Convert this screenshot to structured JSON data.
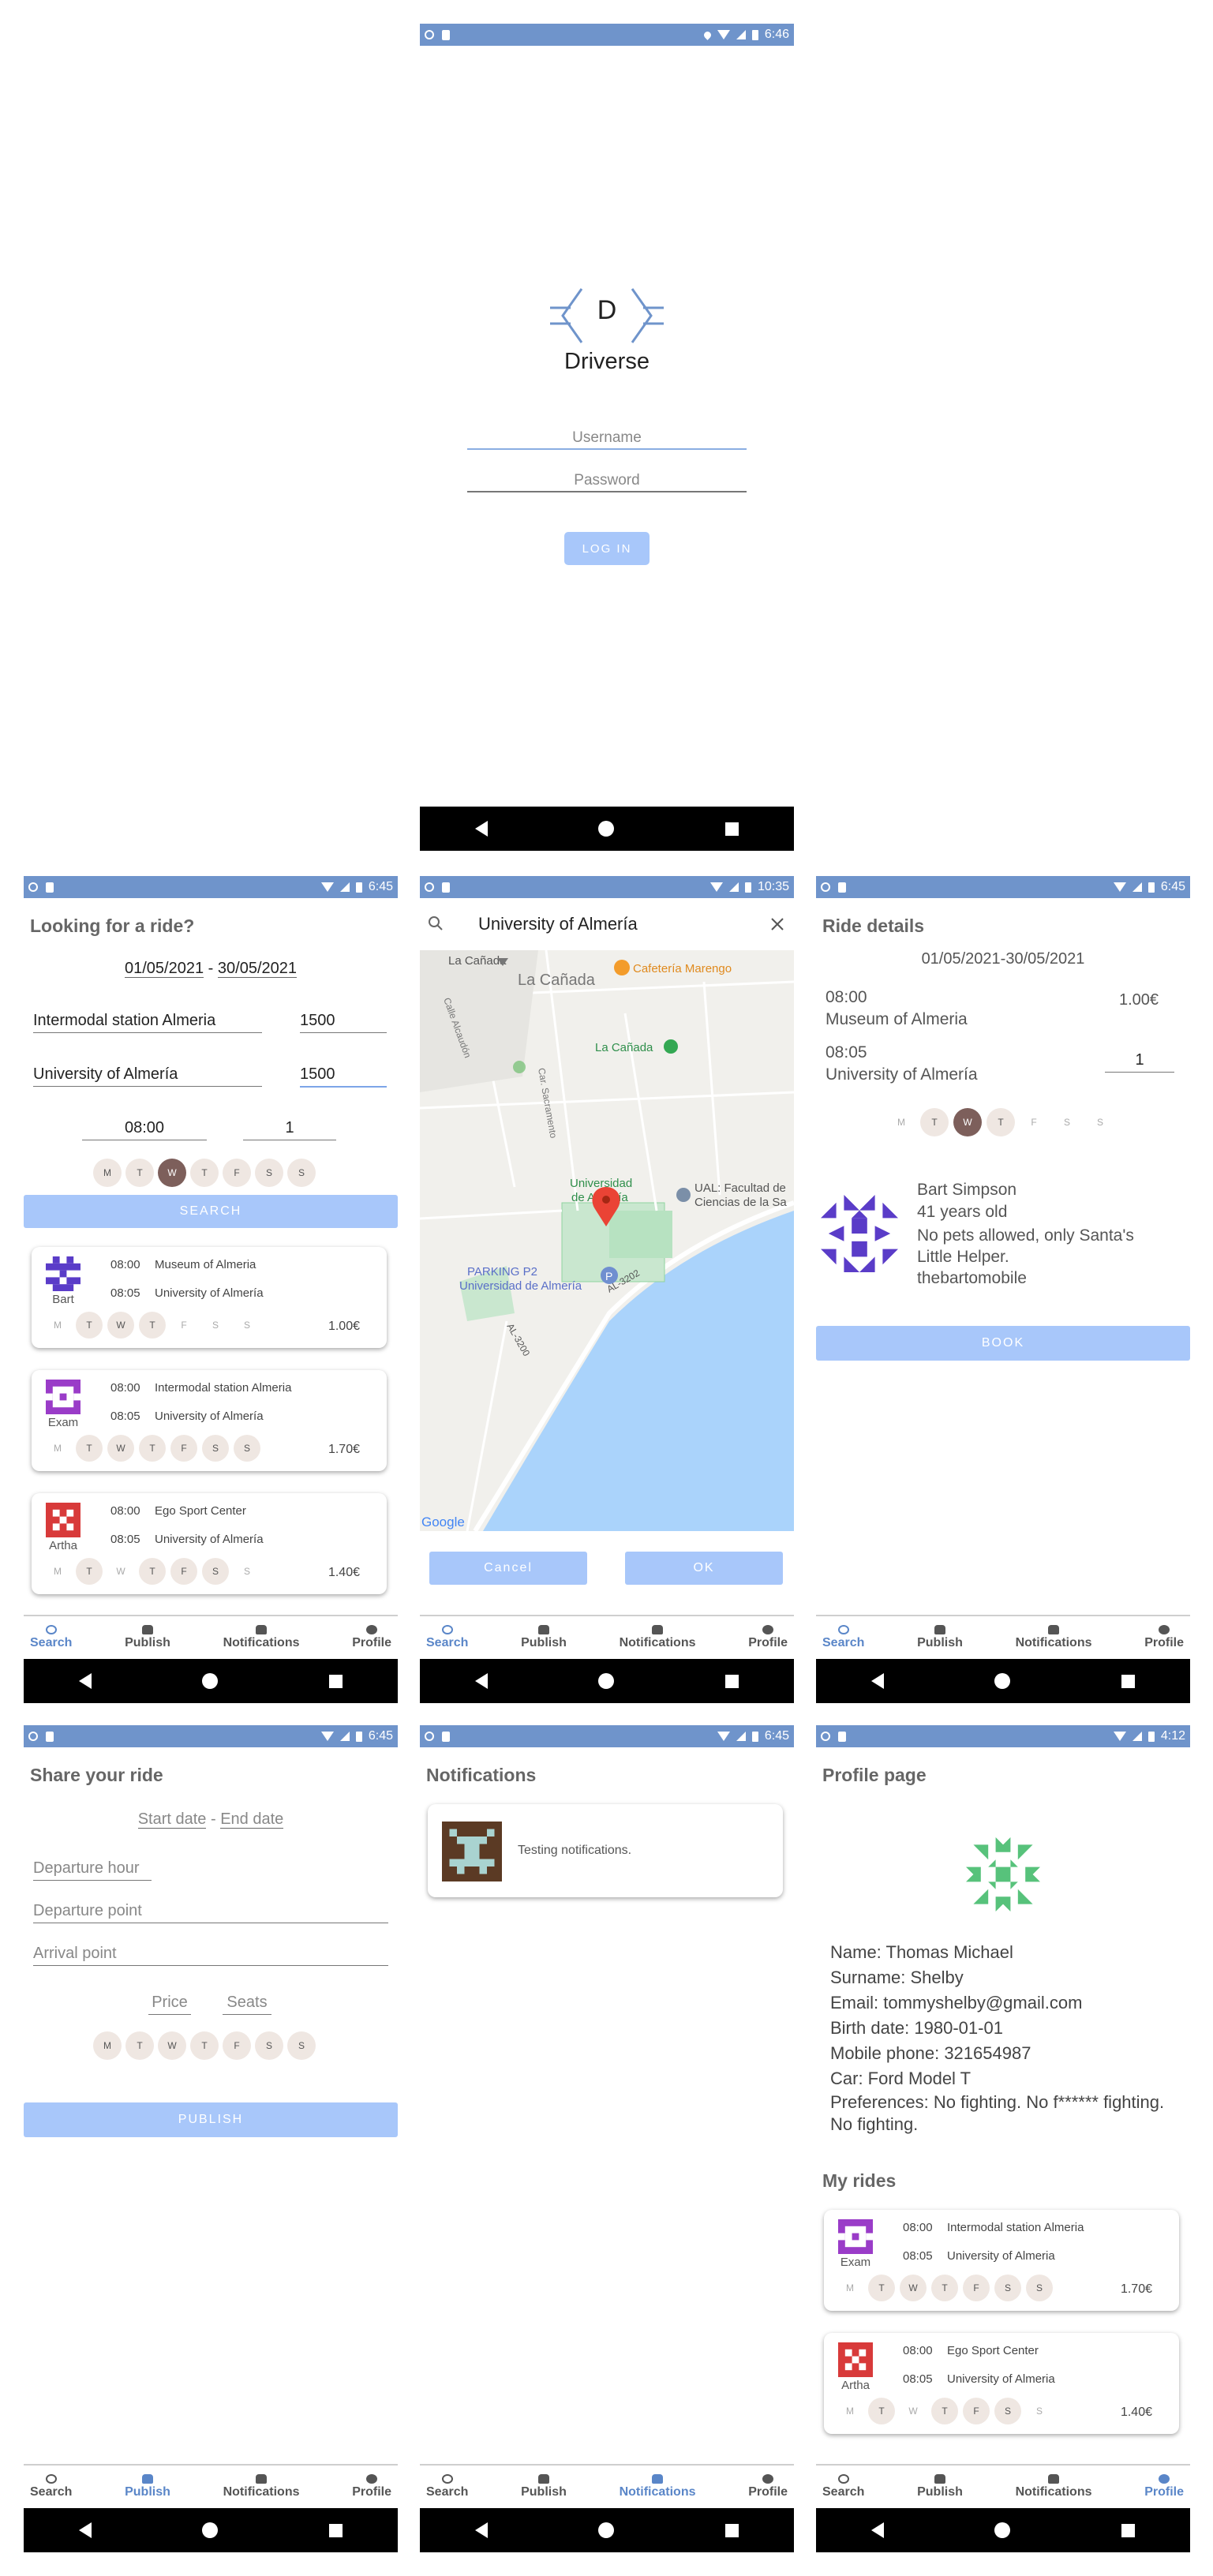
{
  "status": {
    "time_login": "6:46",
    "time_search": "6:45",
    "time_map": "10:35",
    "time_details": "6:45",
    "time_publish": "6:45",
    "time_notif": "6:45",
    "time_profile": "4:12"
  },
  "tabs": {
    "search": "Search",
    "publish": "Publish",
    "notifications": "Notifications",
    "profile": "Profile"
  },
  "login": {
    "logo_letter": "D",
    "app_name": "Driverse",
    "username_placeholder": "Username",
    "password_placeholder": "Password",
    "login_button": "LOG IN"
  },
  "search": {
    "title": "Looking for a ride?",
    "start_date": "01/05/2021",
    "date_sep": "-",
    "end_date": "30/05/2021",
    "from": "Intermodal station Almeria",
    "from_radius": "1500",
    "to": "University of Almería",
    "to_radius": "1500",
    "hour": "08:00",
    "seats": "1",
    "days": [
      "M",
      "T",
      "W",
      "T",
      "F",
      "S",
      "S"
    ],
    "search_button": "SEARCH",
    "results": [
      {
        "user": "Bart",
        "dep_time": "08:00",
        "dep_place": "Museum of Almeria",
        "arr_time": "08:05",
        "arr_place": "University of Almería",
        "price": "1.00€"
      },
      {
        "user": "Exam",
        "dep_time": "08:00",
        "dep_place": "Intermodal station Almeria",
        "arr_time": "08:05",
        "arr_place": "University of Almería",
        "price": "1.70€"
      },
      {
        "user": "Artha",
        "dep_time": "08:00",
        "dep_place": "Ego Sport Center",
        "arr_time": "08:05",
        "arr_place": "University of Almería",
        "price": "1.40€"
      }
    ]
  },
  "map": {
    "search_value": "University of Almería",
    "labels": {
      "lacanada_top": "La Cañada",
      "lacanada": "La Cañada",
      "lacanada_center": "La Cañada",
      "cafeteria": "Cafetería Marengo",
      "univ1": "Universidad",
      "univ2": "de Almería",
      "ual1": "UAL: Facultad de",
      "ual2": "Ciencias de la Sa",
      "parking1": "PARKING P2",
      "parking2": "Universidad de Almería",
      "road1": "AL-3200",
      "road2": "AL-3202",
      "street1": "Calle Alcaudón",
      "street2": "Car. Sacramento",
      "google": "Google"
    },
    "cancel": "Cancel",
    "ok": "OK"
  },
  "details": {
    "title": "Ride details",
    "dates": "01/05/2021-30/05/2021",
    "dep_time": "08:00",
    "dep_place": "Museum of Almeria",
    "price": "1.00€",
    "arr_time": "08:05",
    "arr_place": "University of Almería",
    "seats": "1",
    "driver_name": "Bart Simpson",
    "driver_age": "41 years old",
    "driver_pref": "No pets allowed, only Santa's Little Helper.",
    "driver_user": "thebartomobile",
    "book_button": "BOOK"
  },
  "publish": {
    "title": "Share your ride",
    "start_date": "Start date",
    "date_sep": "-",
    "end_date": "End date",
    "hour": "Departure hour",
    "departure": "Departure point",
    "arrival": "Arrival point",
    "price": "Price",
    "seats": "Seats",
    "publish_button": "PUBLISH"
  },
  "notifications": {
    "title": "Notifications",
    "items": [
      {
        "text": "Testing notifications."
      }
    ]
  },
  "profile": {
    "title": "Profile page",
    "name": "Name: Thomas Michael",
    "surname": "Surname: Shelby",
    "email": "Email: tommyshelby@gmail.com",
    "birth": "Birth date: 1980-01-01",
    "phone": "Mobile phone: 321654987",
    "car": "Car: Ford Model T",
    "prefs": "Preferences: No fighting. No f****** fighting. No fighting.",
    "my_rides_title": "My rides",
    "rides": [
      {
        "user": "Exam",
        "dep_time": "08:00",
        "dep_place": "Intermodal station Almeria",
        "arr_time": "08:05",
        "arr_place": "University of Almeria",
        "price": "1.70€"
      },
      {
        "user": "Artha",
        "dep_time": "08:00",
        "dep_place": "Ego Sport Center",
        "arr_time": "08:05",
        "arr_place": "University of Almeria",
        "price": "1.40€"
      }
    ]
  }
}
